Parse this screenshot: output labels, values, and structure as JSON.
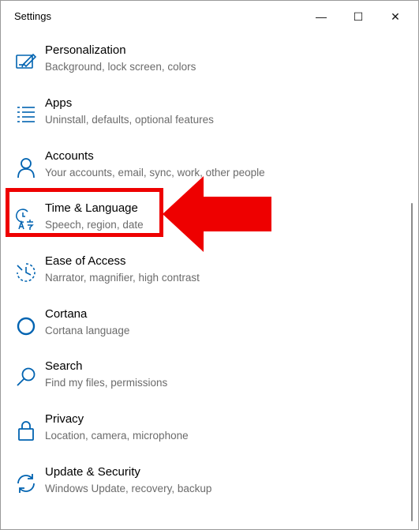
{
  "window": {
    "title": "Settings",
    "controls": {
      "minimize": "—",
      "maximize": "☐",
      "close": "✕"
    }
  },
  "items": [
    {
      "label": "Personalization",
      "desc": "Background, lock screen, colors",
      "icon": "personalization-icon"
    },
    {
      "label": "Apps",
      "desc": "Uninstall, defaults, optional features",
      "icon": "apps-icon"
    },
    {
      "label": "Accounts",
      "desc": "Your accounts, email, sync, work, other people",
      "icon": "accounts-icon"
    },
    {
      "label": "Time & Language",
      "desc": "Speech, region, date",
      "icon": "time-language-icon"
    },
    {
      "label": "Ease of Access",
      "desc": "Narrator, magnifier, high contrast",
      "icon": "ease-of-access-icon"
    },
    {
      "label": "Cortana",
      "desc": "Cortana language",
      "icon": "cortana-icon"
    },
    {
      "label": "Search",
      "desc": "Find my files, permissions",
      "icon": "search-icon"
    },
    {
      "label": "Privacy",
      "desc": "Location, camera, microphone",
      "icon": "privacy-lock-icon"
    },
    {
      "label": "Update & Security",
      "desc": "Windows Update, recovery, backup",
      "icon": "update-sync-icon"
    }
  ],
  "colors": {
    "accent": "#0063b1",
    "annotation": "#ee0000",
    "description_text": "#6b6b6b"
  }
}
